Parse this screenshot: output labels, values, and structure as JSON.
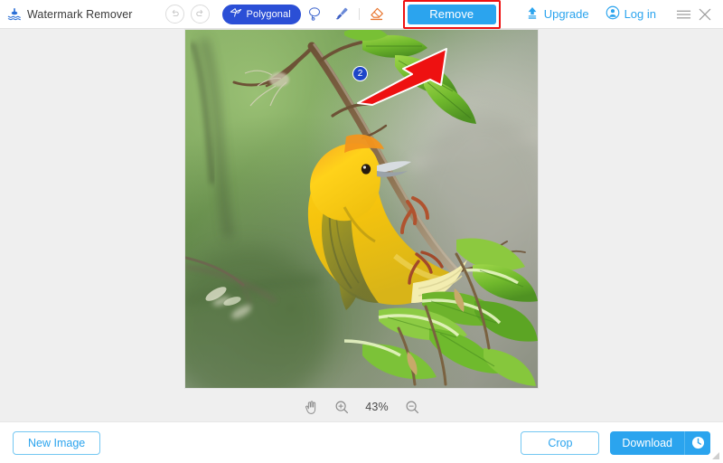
{
  "app": {
    "title": "Watermark Remover",
    "logo_icon": "watermark-drop-icon"
  },
  "header": {
    "undo_icon": "undo-arrow-icon",
    "redo_icon": "redo-arrow-icon",
    "tools": [
      {
        "id": "polygonal",
        "label": "Polygonal",
        "icon": "polygonal-lasso-icon",
        "active": true
      },
      {
        "id": "lasso",
        "label": "",
        "icon": "lasso-icon",
        "active": false
      },
      {
        "id": "brush",
        "label": "",
        "icon": "brush-icon",
        "active": false
      },
      {
        "id": "eraser",
        "label": "",
        "icon": "eraser-icon",
        "active": false
      }
    ],
    "remove_label": "Remove",
    "upgrade_label": "Upgrade",
    "upgrade_icon": "upload-arrow-icon",
    "login_label": "Log in",
    "login_icon": "user-avatar-icon",
    "menu_icon": "hamburger-menu-icon",
    "close_icon": "close-x-icon"
  },
  "canvas": {
    "marker_badge": "2",
    "annotation_arrow": "red-arrow-pointing-to-remove",
    "image_alt": "yellow-weaver-bird-on-branch"
  },
  "zoom": {
    "pan_icon": "hand-pan-icon",
    "zoom_in_icon": "zoom-in-icon",
    "level": "43%",
    "zoom_out_icon": "zoom-out-icon"
  },
  "footer": {
    "new_image_label": "New Image",
    "crop_label": "Crop",
    "download_label": "Download",
    "download_history_icon": "clock-history-icon"
  },
  "colors": {
    "accent_blue": "#2ba4ee",
    "tool_active_blue": "#2b4fd6",
    "highlight_red": "#ee1111",
    "canvas_bg": "#efefef",
    "badge_blue": "#1e46c8"
  }
}
